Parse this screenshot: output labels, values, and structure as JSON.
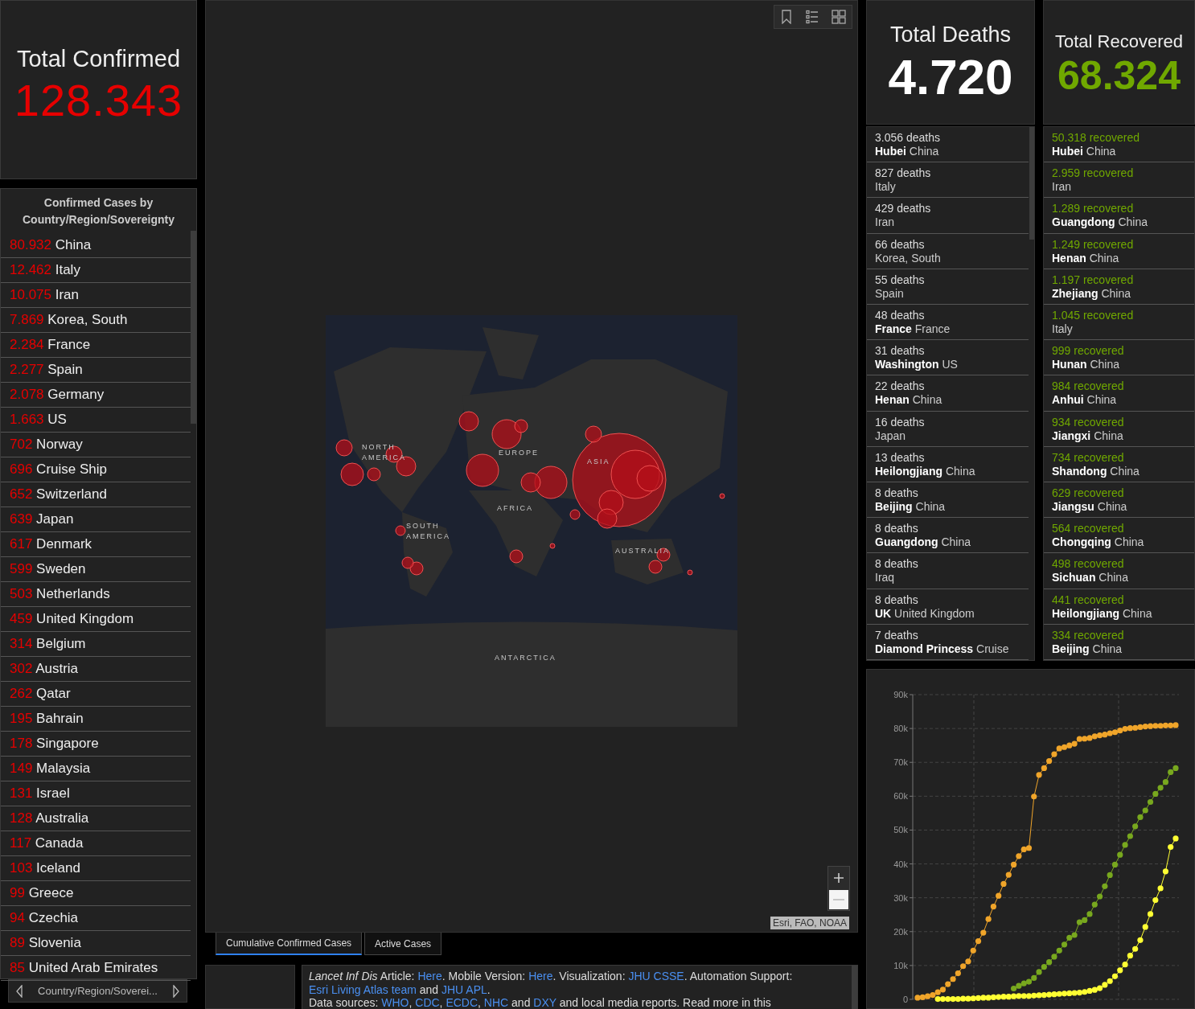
{
  "confirmed_panel": {
    "title": "Total Confirmed",
    "value": "128.343"
  },
  "country_list": {
    "title": "Confirmed Cases by Country/Region/Sovereignty",
    "items": [
      {
        "count": "80.932",
        "name": "China"
      },
      {
        "count": "12.462",
        "name": "Italy"
      },
      {
        "count": "10.075",
        "name": "Iran"
      },
      {
        "count": "7.869",
        "name": "Korea, South"
      },
      {
        "count": "2.284",
        "name": "France"
      },
      {
        "count": "2.277",
        "name": "Spain"
      },
      {
        "count": "2.078",
        "name": "Germany"
      },
      {
        "count": "1.663",
        "name": "US"
      },
      {
        "count": "702",
        "name": "Norway"
      },
      {
        "count": "696",
        "name": "Cruise Ship"
      },
      {
        "count": "652",
        "name": "Switzerland"
      },
      {
        "count": "639",
        "name": "Japan"
      },
      {
        "count": "617",
        "name": "Denmark"
      },
      {
        "count": "599",
        "name": "Sweden"
      },
      {
        "count": "503",
        "name": "Netherlands"
      },
      {
        "count": "459",
        "name": "United Kingdom"
      },
      {
        "count": "314",
        "name": "Belgium"
      },
      {
        "count": "302",
        "name": "Austria"
      },
      {
        "count": "262",
        "name": "Qatar"
      },
      {
        "count": "195",
        "name": "Bahrain"
      },
      {
        "count": "178",
        "name": "Singapore"
      },
      {
        "count": "149",
        "name": "Malaysia"
      },
      {
        "count": "131",
        "name": "Israel"
      },
      {
        "count": "128",
        "name": "Australia"
      },
      {
        "count": "117",
        "name": "Canada"
      },
      {
        "count": "103",
        "name": "Iceland"
      },
      {
        "count": "99",
        "name": "Greece"
      },
      {
        "count": "94",
        "name": "Czechia"
      },
      {
        "count": "89",
        "name": "Slovenia"
      },
      {
        "count": "85",
        "name": "United Arab Emirates"
      }
    ]
  },
  "list_nav": {
    "label": "Country/Region/Soverei..."
  },
  "map": {
    "labels": [
      "NORTH AMERICA",
      "EUROPE",
      "ASIA",
      "AFRICA",
      "SOUTH AMERICA",
      "AUSTRALIA",
      "ANTARCTICA"
    ],
    "attribution": "Esri, FAO, NOAA"
  },
  "map_tabs": [
    {
      "label": "Cumulative Confirmed Cases",
      "selected": true
    },
    {
      "label": "Active Cases",
      "selected": false
    }
  ],
  "credits": [
    {
      "kind": "italic",
      "text": "Lancet Inf Dis"
    },
    {
      "kind": "text",
      "text": " Article: "
    },
    {
      "kind": "link",
      "text": "Here"
    },
    {
      "kind": "text",
      "text": ". Mobile Version: "
    },
    {
      "kind": "link",
      "text": "Here"
    },
    {
      "kind": "text",
      "text": ". Visualization: "
    },
    {
      "kind": "link",
      "text": "JHU CSSE"
    },
    {
      "kind": "text",
      "text": ". Automation Support: "
    },
    {
      "kind": "break"
    },
    {
      "kind": "link",
      "text": "Esri Living Atlas team"
    },
    {
      "kind": "text",
      "text": " and "
    },
    {
      "kind": "link",
      "text": "JHU APL"
    },
    {
      "kind": "text",
      "text": "."
    },
    {
      "kind": "break"
    },
    {
      "kind": "text",
      "text": "Data sources: "
    },
    {
      "kind": "link",
      "text": "WHO"
    },
    {
      "kind": "text",
      "text": ", "
    },
    {
      "kind": "link",
      "text": "CDC"
    },
    {
      "kind": "text",
      "text": ", "
    },
    {
      "kind": "link",
      "text": "ECDC"
    },
    {
      "kind": "text",
      "text": ", "
    },
    {
      "kind": "link",
      "text": "NHC"
    },
    {
      "kind": "text",
      "text": " and "
    },
    {
      "kind": "link",
      "text": "DXY"
    },
    {
      "kind": "text",
      "text": " and local media reports. Read more in this"
    }
  ],
  "deaths_panel": {
    "title": "Total Deaths",
    "value": "4.720",
    "items": [
      {
        "count": "3.056",
        "unit": "deaths",
        "region": "Hubei",
        "country": "China"
      },
      {
        "count": "827",
        "unit": "deaths",
        "country": "Italy"
      },
      {
        "count": "429",
        "unit": "deaths",
        "country": "Iran"
      },
      {
        "count": "66",
        "unit": "deaths",
        "country": "Korea, South"
      },
      {
        "count": "55",
        "unit": "deaths",
        "country": "Spain"
      },
      {
        "count": "48",
        "unit": "deaths",
        "region": "France",
        "country": "France"
      },
      {
        "count": "31",
        "unit": "deaths",
        "region": "Washington",
        "country": "US"
      },
      {
        "count": "22",
        "unit": "deaths",
        "region": "Henan",
        "country": "China"
      },
      {
        "count": "16",
        "unit": "deaths",
        "country": "Japan"
      },
      {
        "count": "13",
        "unit": "deaths",
        "region": "Heilongjiang",
        "country": "China"
      },
      {
        "count": "8",
        "unit": "deaths",
        "region": "Beijing",
        "country": "China"
      },
      {
        "count": "8",
        "unit": "deaths",
        "region": "Guangdong",
        "country": "China"
      },
      {
        "count": "8",
        "unit": "deaths",
        "country": "Iraq"
      },
      {
        "count": "8",
        "unit": "deaths",
        "region": "UK",
        "country": "United Kingdom"
      },
      {
        "count": "7",
        "unit": "deaths",
        "region": "Diamond Princess",
        "country": "Cruise"
      }
    ]
  },
  "recovered_panel": {
    "title": "Total Recovered",
    "value": "68.324",
    "items": [
      {
        "count": "50.318",
        "unit": "recovered",
        "region": "Hubei",
        "country": "China"
      },
      {
        "count": "2.959",
        "unit": "recovered",
        "country": "Iran"
      },
      {
        "count": "1.289",
        "unit": "recovered",
        "region": "Guangdong",
        "country": "China"
      },
      {
        "count": "1.249",
        "unit": "recovered",
        "region": "Henan",
        "country": "China"
      },
      {
        "count": "1.197",
        "unit": "recovered",
        "region": "Zhejiang",
        "country": "China"
      },
      {
        "count": "1.045",
        "unit": "recovered",
        "country": "Italy"
      },
      {
        "count": "999",
        "unit": "recovered",
        "region": "Hunan",
        "country": "China"
      },
      {
        "count": "984",
        "unit": "recovered",
        "region": "Anhui",
        "country": "China"
      },
      {
        "count": "934",
        "unit": "recovered",
        "region": "Jiangxi",
        "country": "China"
      },
      {
        "count": "734",
        "unit": "recovered",
        "region": "Shandong",
        "country": "China"
      },
      {
        "count": "629",
        "unit": "recovered",
        "region": "Jiangsu",
        "country": "China"
      },
      {
        "count": "564",
        "unit": "recovered",
        "region": "Chongqing",
        "country": "China"
      },
      {
        "count": "498",
        "unit": "recovered",
        "region": "Sichuan",
        "country": "China"
      },
      {
        "count": "441",
        "unit": "recovered",
        "region": "Heilongjiang",
        "country": "China"
      },
      {
        "count": "334",
        "unit": "recovered",
        "region": "Beijing",
        "country": "China"
      }
    ]
  },
  "trend_chart": {
    "chart_data": {
      "type": "line",
      "grid": true,
      "ylim": [
        0,
        90000
      ],
      "yticks": [
        {
          "value": 0,
          "label": "0"
        },
        {
          "value": 10000,
          "label": "10k"
        },
        {
          "value": 20000,
          "label": "20k"
        },
        {
          "value": 30000,
          "label": "30k"
        },
        {
          "value": 40000,
          "label": "40k"
        },
        {
          "value": 50000,
          "label": "50k"
        },
        {
          "value": 60000,
          "label": "60k"
        },
        {
          "value": 70000,
          "label": "70k"
        },
        {
          "value": 80000,
          "label": "80k"
        },
        {
          "value": 90000,
          "label": "90k"
        }
      ],
      "series": [
        {
          "color": "#f0a52a",
          "marker": true,
          "values": [
            500,
            600,
            900,
            1300,
            2100,
            2900,
            4500,
            6000,
            7700,
            9800,
            11200,
            14400,
            17200,
            19700,
            23700,
            27400,
            30600,
            34100,
            36800,
            39800,
            42300,
            44300,
            44700,
            59900,
            66300,
            68300,
            70400,
            72400,
            74100,
            74500,
            75000,
            75500,
            76900,
            77000,
            77200,
            77700,
            78000,
            78200,
            78600,
            78900,
            79400,
            79900,
            80100,
            80200,
            80400,
            80600,
            80700,
            80800,
            80800,
            80900,
            80900,
            81000
          ]
        },
        {
          "color": "#78a81e",
          "marker": true,
          "values": [
            null,
            null,
            null,
            null,
            null,
            null,
            null,
            null,
            null,
            null,
            null,
            null,
            null,
            null,
            null,
            null,
            null,
            null,
            null,
            3200,
            4000,
            4700,
            5200,
            6300,
            8100,
            9600,
            11000,
            12600,
            14400,
            16200,
            18200,
            19000,
            22800,
            23400,
            25200,
            28000,
            30400,
            33400,
            36700,
            39800,
            42700,
            45600,
            48200,
            51100,
            53800,
            55800,
            58300,
            60700,
            62500,
            64200,
            67100,
            68300
          ]
        },
        {
          "color": "#ffff33",
          "marker": true,
          "values": [
            null,
            null,
            null,
            null,
            100,
            100,
            100,
            100,
            100,
            200,
            200,
            300,
            400,
            500,
            500,
            600,
            700,
            800,
            800,
            900,
            1000,
            1000,
            1000,
            1100,
            1200,
            1300,
            1400,
            1500,
            1600,
            1700,
            1800,
            1900,
            2000,
            2200,
            2500,
            2800,
            3300,
            4300,
            5400,
            6800,
            8600,
            10300,
            12900,
            14900,
            17500,
            21400,
            25200,
            29300,
            32800,
            37800,
            45000,
            47500
          ]
        }
      ]
    }
  }
}
